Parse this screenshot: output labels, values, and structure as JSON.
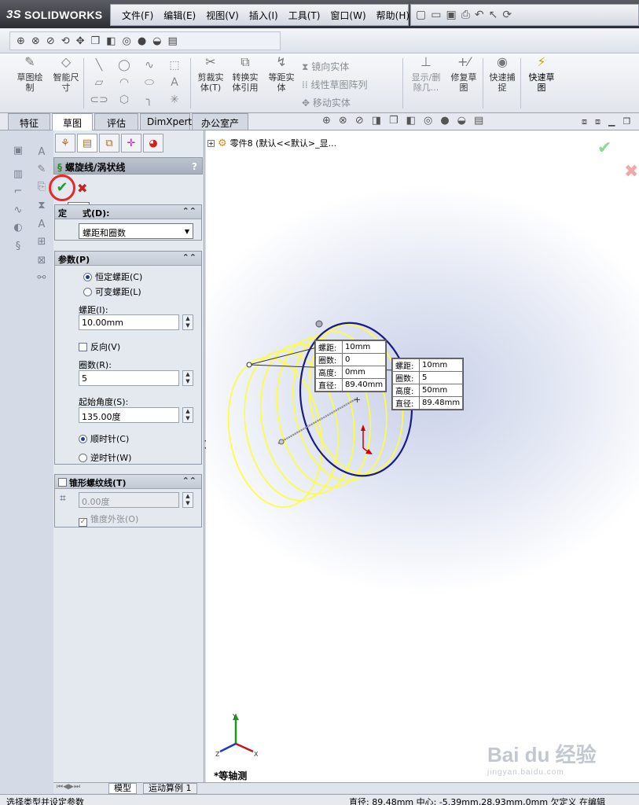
{
  "app": {
    "logo_prefix": "3S",
    "logo_text": "SOLIDWORKS"
  },
  "menu": [
    "文件(F)",
    "编辑(E)",
    "视图(V)",
    "插入(I)",
    "工具(T)",
    "窗口(W)",
    "帮助(H)"
  ],
  "commands": {
    "sketch": "草图绘\n制",
    "smart_dim": "智能尺\n寸",
    "trim": "剪裁实\n体(T)",
    "convert": "转换实\n体引用",
    "offset": "等距实\n体",
    "mirror": "镜向实体",
    "linear_pattern": "线性草图阵列",
    "move": "移动实体",
    "show_delete": "显示/删\n除几...",
    "repair": "修复草\n图",
    "quick_snap": "快速捕\n捉",
    "rapid_sketch": "快速草\n图"
  },
  "tabs": [
    "特征",
    "草图",
    "评估",
    "DimXpert",
    "办公室产品"
  ],
  "active_tab": "草图",
  "property_manager": {
    "title": "螺旋线/涡状线",
    "help": "?",
    "ok_tooltip": "确定",
    "definition": {
      "header_visible": "定",
      "header_hidden_suffix": "式(D):",
      "selected": "螺距和圈数"
    },
    "parameters": {
      "header": "参数(P)",
      "constant_pitch": "恒定螺距(C)",
      "variable_pitch": "可变螺距(L)",
      "pitch_label": "螺距(I):",
      "pitch_value": "10.00mm",
      "reverse_label": "反向(V)",
      "revolutions_label": "圈数(R):",
      "revolutions_value": "5",
      "start_angle_label": "起始角度(S):",
      "start_angle_value": "135.00度",
      "clockwise": "顺时针(C)",
      "counterclockwise": "逆时针(W)"
    },
    "taper": {
      "header": "锥形螺纹线(T)",
      "angle_value": "0.00度",
      "taper_outward": "锥度外张(O)"
    }
  },
  "graphics": {
    "tree_item": "零件8 (默认<<默认>_显...",
    "view_name": "*等轴测",
    "callout_start": [
      {
        "k": "螺距:",
        "v": "10mm"
      },
      {
        "k": "圈数:",
        "v": "0"
      },
      {
        "k": "高度:",
        "v": "0mm"
      },
      {
        "k": "直径:",
        "v": "89.40mm"
      }
    ],
    "callout_end": [
      {
        "k": "螺距:",
        "v": "10mm"
      },
      {
        "k": "圈数:",
        "v": "5"
      },
      {
        "k": "高度:",
        "v": "50mm"
      },
      {
        "k": "直径:",
        "v": "89.48mm"
      }
    ],
    "helix_color": "#ffff33",
    "circle_color": "#1a1a8c"
  },
  "bottom_tabs": [
    "模型",
    "运动算例 1"
  ],
  "status": {
    "message": "选择类型并设定参数",
    "right": "直径: 89.48mm  中心: -5.39mm,28.93mm,0mm  欠定义  在编辑"
  },
  "watermark": {
    "text": "Bai du 经验",
    "sub": "jingyan.baidu.com"
  }
}
